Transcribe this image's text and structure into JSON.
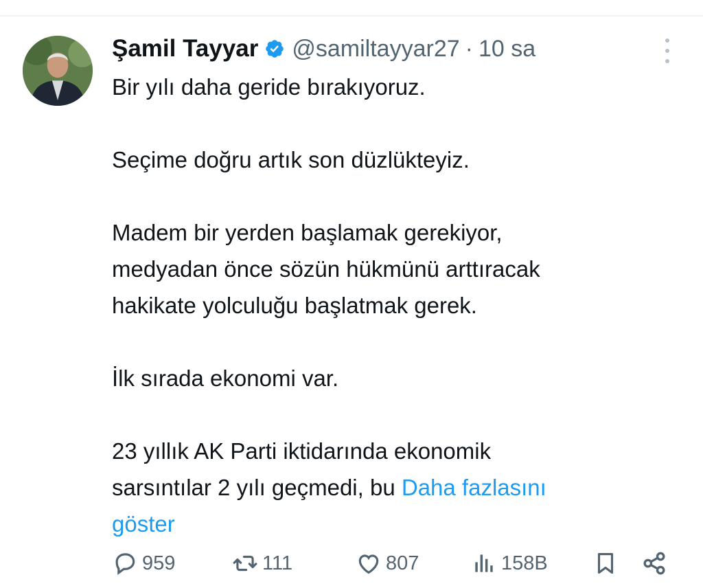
{
  "tweet": {
    "author": {
      "display_name": "Şamil Tayyar",
      "handle": "@samiltayyar27",
      "verified": true,
      "verified_color": "#1d9bf0"
    },
    "separator": "·",
    "time": "10 sa",
    "lines": [
      "Bir yılı daha geride bırakıyoruz.",
      "",
      "Seçime doğru artık son düzlükteyiz.",
      "",
      "Madem bir yerden başlamak gerekiyor,",
      "medyadan önce sözün hükmünü arttıracak",
      "hakikate yolculuğu başlatmak gerek.",
      "",
      "İlk sırada ekonomi var.",
      "",
      "23 yıllık AK Parti iktidarında ekonomik",
      "sarsıntılar 2 yılı geçmedi, bu "
    ],
    "show_more_label_line1": "Daha fazlasını",
    "show_more_label_line2": "göster",
    "link_color": "#1d9bf0"
  },
  "actions": {
    "reply": {
      "icon": "reply-icon",
      "count": "959"
    },
    "retweet": {
      "icon": "retweet-icon",
      "count": "111"
    },
    "like": {
      "icon": "heart-icon",
      "count": "807"
    },
    "views": {
      "icon": "views-icon",
      "count": "158B"
    },
    "bookmark": {
      "icon": "bookmark-icon"
    },
    "share": {
      "icon": "share-icon"
    }
  }
}
